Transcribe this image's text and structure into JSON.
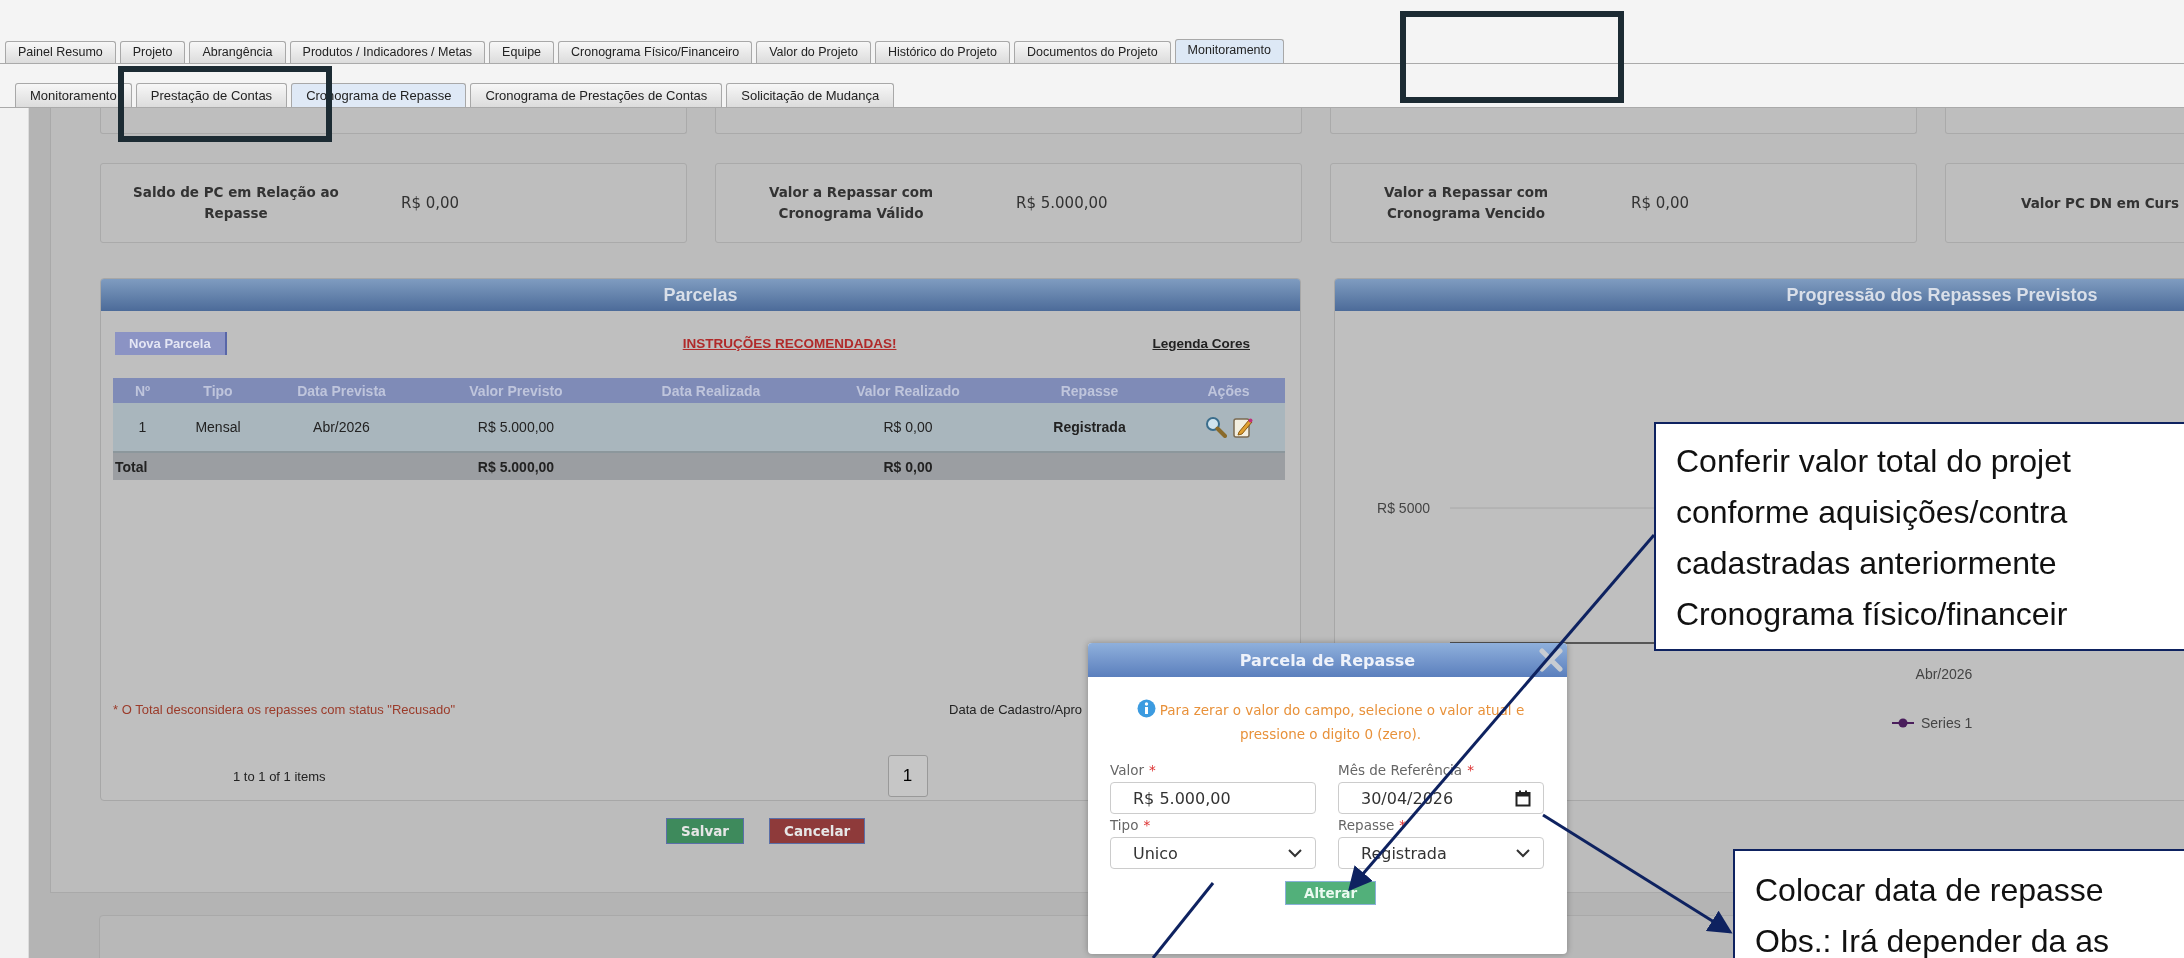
{
  "tabs": [
    {
      "label": "Painel Resumo",
      "selected": false
    },
    {
      "label": "Projeto",
      "selected": false
    },
    {
      "label": "Abrangência",
      "selected": false
    },
    {
      "label": "Produtos / Indicadores / Metas",
      "selected": false
    },
    {
      "label": "Equipe",
      "selected": false
    },
    {
      "label": "Cronograma Físico/Financeiro",
      "selected": false
    },
    {
      "label": "Valor do Projeto",
      "selected": false
    },
    {
      "label": "Histórico do Projeto",
      "selected": false
    },
    {
      "label": "Documentos do Projeto",
      "selected": false
    },
    {
      "label": "Monitoramento",
      "selected": true
    }
  ],
  "subtabs": [
    {
      "label": "Monitoramento",
      "selected": false
    },
    {
      "label": "Prestação de Contas",
      "selected": false
    },
    {
      "label": "Cronograma de Repasse",
      "selected": true
    },
    {
      "label": "Cronograma de Prestações de Contas",
      "selected": false
    },
    {
      "label": "Solicitação de Mudança",
      "selected": false
    }
  ],
  "summary_cards": [
    {
      "label": "Saldo de PC em Relação ao Repasse",
      "value": "R$ 0,00"
    },
    {
      "label": "Valor a Repassar com Cronograma Válido",
      "value": "R$ 5.000,00"
    },
    {
      "label": "Valor a Repassar com Cronograma Vencido",
      "value": "R$ 0,00"
    },
    {
      "label": "Valor PC DN em Curs"
    }
  ],
  "parcelas": {
    "title": "Parcelas",
    "new_button": "Nova Parcela",
    "instructions_link": "INSTRUÇÕES RECOMENDADAS!",
    "legend_link": "Legenda Cores",
    "columns": [
      "Nº",
      "Tipo",
      "Data Prevista",
      "Valor Previsto",
      "Data Realizada",
      "Valor Realizado",
      "Repasse",
      "Ações"
    ],
    "rows": [
      {
        "n": "1",
        "tipo": "Mensal",
        "data_prevista": "Abr/2026",
        "valor_previsto": "R$ 5.000,00",
        "valor_realizado": "R$ 0,00",
        "repasse": "Registrada"
      }
    ],
    "total": {
      "label": "Total",
      "valor_previsto": "R$ 5.000,00",
      "valor_realizado": "R$ 0,00"
    },
    "footnote": "* O Total desconsidera os repasses com status \"Recusado\"",
    "date_label": "Data de Cadastro/Apro",
    "pager_info": "1 to 1 of 1 items",
    "page": "1"
  },
  "buttons": [
    {
      "label": "Salvar",
      "kind": "save"
    },
    {
      "label": "Cancelar",
      "kind": "cancel"
    }
  ],
  "chart": {
    "title": "Progressão dos Repasses Previstos",
    "y_label": "R$ 5000",
    "x_label": "Abr/2026",
    "legend": "Series 1"
  },
  "modal": {
    "title": "Parcela de Repasse",
    "info": "Para zerar o valor do campo, selecione o valor atual e pressione o digito 0 (zero).",
    "fields": [
      {
        "label": "Valor",
        "mark": "*",
        "kind": "text",
        "value": "R$ 5.000,00"
      },
      {
        "label": "Mês de Referência",
        "mark": "*",
        "kind": "date",
        "value": "30/04/2026"
      },
      {
        "label": "Tipo",
        "mark": "*",
        "kind": "select",
        "value": "Unico"
      },
      {
        "label": "Repasse",
        "mark": "*",
        "kind": "select",
        "value": "Registrada"
      }
    ],
    "submit": "Alterar"
  },
  "callouts": [
    {
      "lines": [
        "Conferir valor total do projet",
        "conforme aquisições/contra",
        "cadastradas anteriormente",
        "Cronograma físico/financeir"
      ]
    },
    {
      "lines": [
        "Colocar data de repasse",
        "Obs.: Irá depender da as"
      ]
    }
  ]
}
